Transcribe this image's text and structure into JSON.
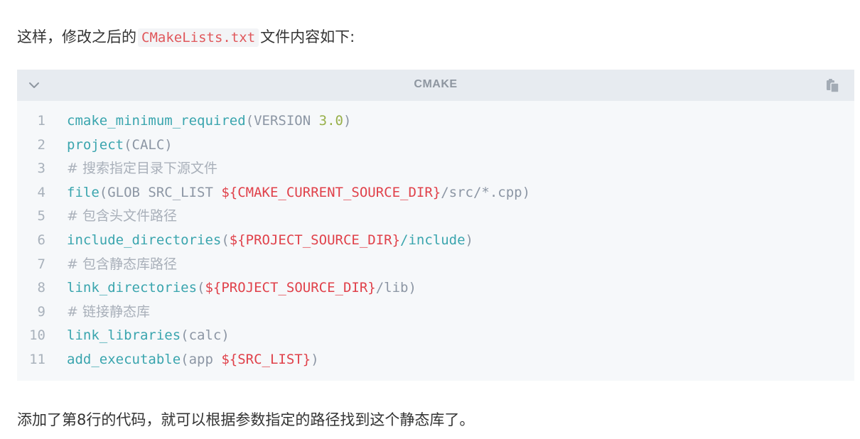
{
  "intro": {
    "before": "这样，修改之后的",
    "code": "CMakeLists.txt",
    "after": "文件内容如下:"
  },
  "code_block": {
    "language": "CMAKE",
    "collapse_icon": "chevron-down-icon",
    "copy_icon": "copy-icon",
    "lines": [
      {
        "num": "1",
        "tokens": [
          {
            "t": "cmake_minimum_required",
            "k": "fn"
          },
          {
            "t": "(VERSION ",
            "k": "pl"
          },
          {
            "t": "3.0",
            "k": "num"
          },
          {
            "t": ")",
            "k": "pl"
          }
        ]
      },
      {
        "num": "2",
        "tokens": [
          {
            "t": "project",
            "k": "fn"
          },
          {
            "t": "(CALC)",
            "k": "pl"
          }
        ]
      },
      {
        "num": "3",
        "tokens": [
          {
            "t": "# 搜索指定目录下源文件",
            "k": "cmt"
          }
        ]
      },
      {
        "num": "4",
        "tokens": [
          {
            "t": "file",
            "k": "fn"
          },
          {
            "t": "(GLOB SRC_LIST ",
            "k": "pl"
          },
          {
            "t": "${CMAKE_CURRENT_SOURCE_DIR}",
            "k": "var"
          },
          {
            "t": "/src/*.cpp)",
            "k": "pl"
          }
        ]
      },
      {
        "num": "5",
        "tokens": [
          {
            "t": "# 包含头文件路径",
            "k": "cmt"
          }
        ]
      },
      {
        "num": "6",
        "tokens": [
          {
            "t": "include_directories",
            "k": "fn"
          },
          {
            "t": "(",
            "k": "pl"
          },
          {
            "t": "${PROJECT_SOURCE_DIR}",
            "k": "var"
          },
          {
            "t": "/include",
            "k": "fn"
          },
          {
            "t": ")",
            "k": "pl"
          }
        ]
      },
      {
        "num": "7",
        "tokens": [
          {
            "t": "# 包含静态库路径",
            "k": "cmt"
          }
        ]
      },
      {
        "num": "8",
        "tokens": [
          {
            "t": "link_directories",
            "k": "fn"
          },
          {
            "t": "(",
            "k": "pl"
          },
          {
            "t": "${PROJECT_SOURCE_DIR}",
            "k": "var"
          },
          {
            "t": "/lib)",
            "k": "pl"
          }
        ]
      },
      {
        "num": "9",
        "tokens": [
          {
            "t": "# 链接静态库",
            "k": "cmt"
          }
        ]
      },
      {
        "num": "10",
        "tokens": [
          {
            "t": "link_libraries",
            "k": "fn"
          },
          {
            "t": "(calc)",
            "k": "pl"
          }
        ]
      },
      {
        "num": "11",
        "tokens": [
          {
            "t": "add_executable",
            "k": "fn"
          },
          {
            "t": "(app ",
            "k": "pl"
          },
          {
            "t": "${SRC_LIST}",
            "k": "var"
          },
          {
            "t": ")",
            "k": "pl"
          }
        ]
      }
    ]
  },
  "outro": "添加了第8行的代码，就可以根据参数指定的路径找到这个静态库了。"
}
